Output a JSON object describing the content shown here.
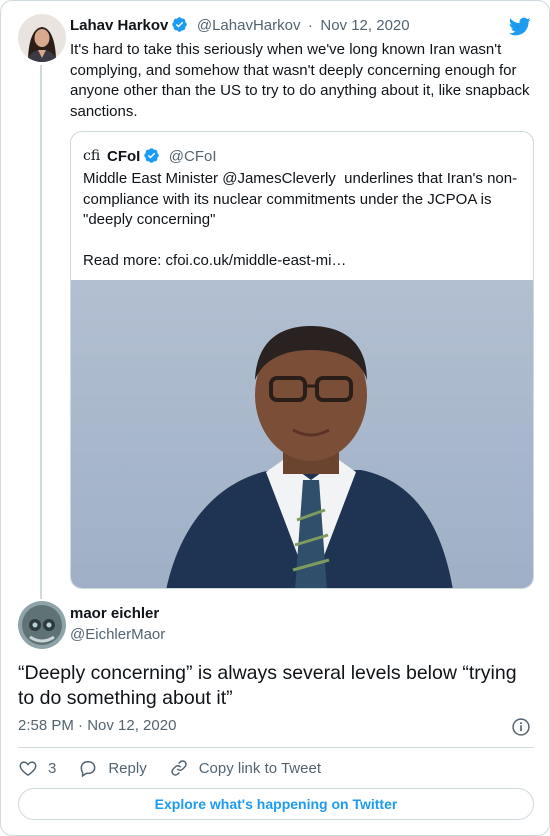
{
  "parent_tweet": {
    "name": "Lahav Harkov",
    "handle": "@LahavHarkov",
    "separator": "·",
    "date": "Nov 12, 2020",
    "text": "It's hard to take this seriously when we've long known Iran wasn't complying, and somehow that wasn't deeply concerning enough for anyone other than the US to try to do anything about it, like snapback sanctions."
  },
  "quoted_tweet": {
    "logo_text": "cfi",
    "name": "CFoI",
    "handle": "@CFoI",
    "text": "Middle East Minister @JamesCleverly  underlines that Iran's non-compliance with its nuclear commitments under the JCPOA is \"deeply concerning\"\n\nRead more: cfoi.co.uk/middle-east-mi…"
  },
  "main_tweet": {
    "name": "maor eichler",
    "handle": "@EichlerMaor",
    "text": "“Deeply concerning” is always several levels below “trying to do something about it”",
    "timestamp": "2:58 PM · Nov 12, 2020"
  },
  "actions": {
    "like_count": "3",
    "reply_label": "Reply",
    "copy_link_label": "Copy link to Tweet"
  },
  "footer": {
    "explore_label": "Explore what's happening on Twitter"
  },
  "colors": {
    "brand_blue": "#1d9bf0",
    "text": "#0f1419",
    "secondary_text": "#536471",
    "border": "#cfd9de"
  },
  "icons": [
    "verified-badge-icon",
    "twitter-bird-icon",
    "info-icon",
    "heart-icon",
    "reply-bubble-icon",
    "link-icon"
  ]
}
